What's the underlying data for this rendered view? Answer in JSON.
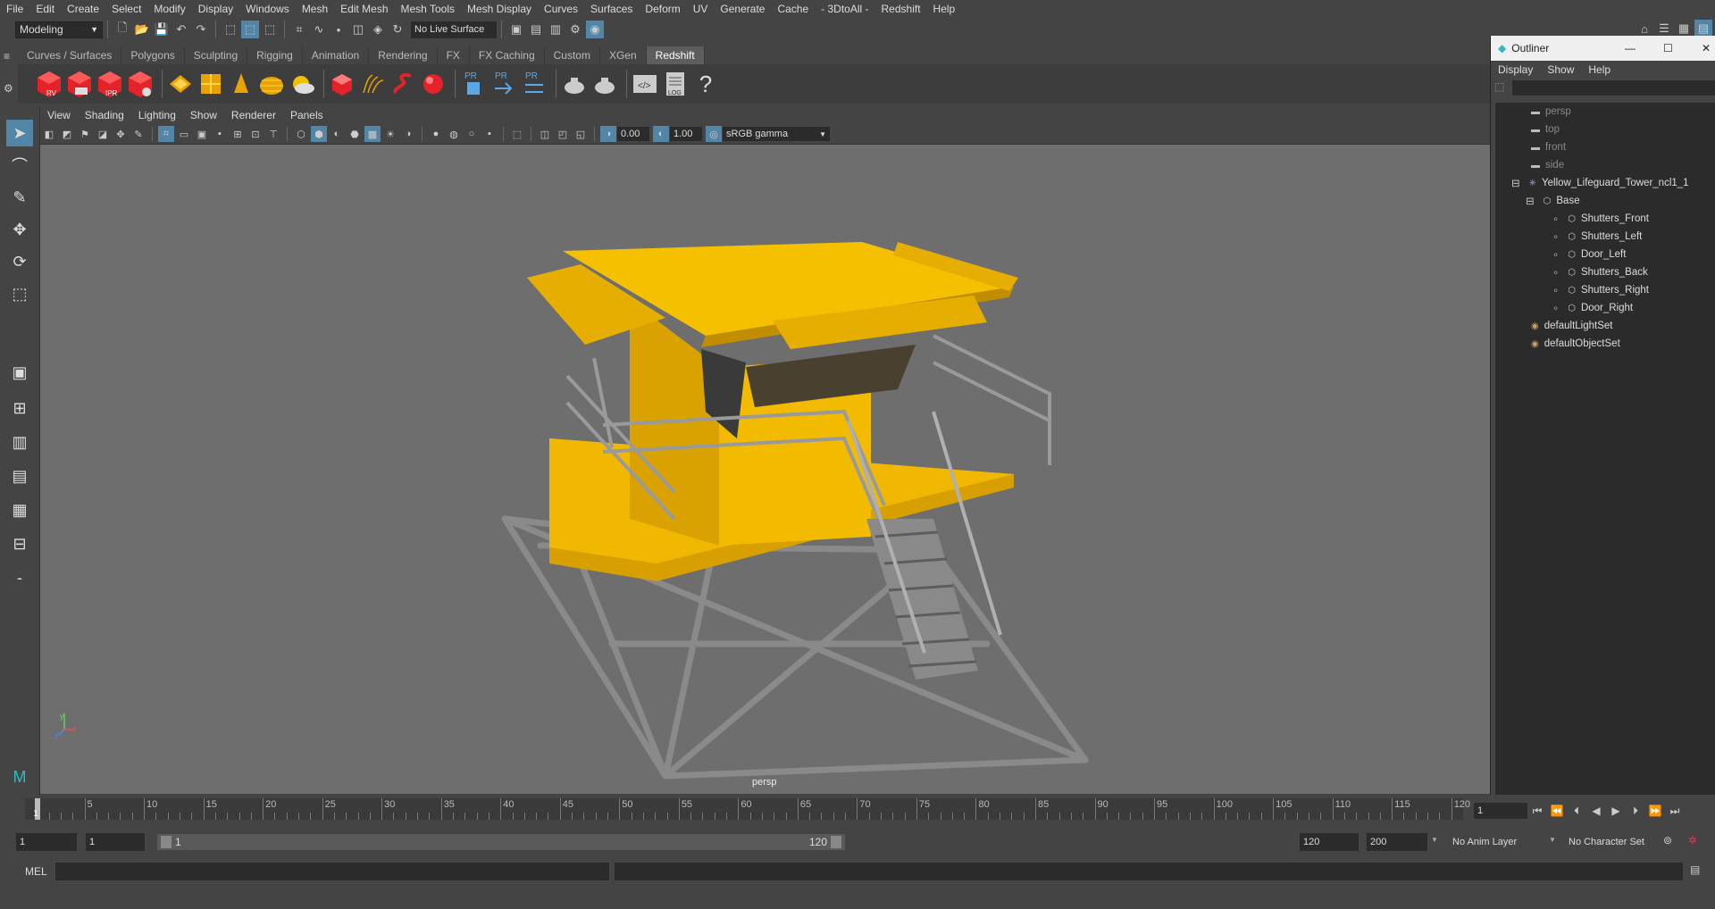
{
  "menubar": [
    "File",
    "Edit",
    "Create",
    "Select",
    "Modify",
    "Display",
    "Windows",
    "Mesh",
    "Edit Mesh",
    "Mesh Tools",
    "Mesh Display",
    "Curves",
    "Surfaces",
    "Deform",
    "UV",
    "Generate",
    "Cache",
    "- 3DtoAll -",
    "Redshift",
    "Help"
  ],
  "status": {
    "mode": "Modeling",
    "live_surface": "No Live Surface"
  },
  "shelf_tabs": [
    "Curves / Surfaces",
    "Polygons",
    "Sculpting",
    "Rigging",
    "Animation",
    "Rendering",
    "FX",
    "FX Caching",
    "Custom",
    "XGen",
    "Redshift"
  ],
  "shelf_active": "Redshift",
  "shelf_icon_labels": {
    "rv": "RV",
    "ipr": "IPR",
    "pr": "PR",
    "log": "LOG",
    "help": "?"
  },
  "panel_menu": [
    "View",
    "Shading",
    "Lighting",
    "Show",
    "Renderer",
    "Panels"
  ],
  "panel_fields": {
    "exposure": "0.00",
    "gamma": "1.00",
    "colorspace": "sRGB gamma"
  },
  "viewport": {
    "camera_label": "persp",
    "axis_x": "x",
    "axis_y": "y",
    "axis_z": "z"
  },
  "outliner": {
    "title": "Outliner",
    "menu": [
      "Display",
      "Show",
      "Help"
    ],
    "items": [
      {
        "label": "persp",
        "type": "camera",
        "dim": true
      },
      {
        "label": "top",
        "type": "camera",
        "dim": true
      },
      {
        "label": "front",
        "type": "camera",
        "dim": true
      },
      {
        "label": "side",
        "type": "camera",
        "dim": true
      },
      {
        "label": "Yellow_Lifeguard_Tower_ncl1_1",
        "type": "group"
      },
      {
        "label": "Base",
        "type": "mesh"
      },
      {
        "label": "Shutters_Front",
        "type": "mesh"
      },
      {
        "label": "Shutters_Left",
        "type": "mesh"
      },
      {
        "label": "Door_Left",
        "type": "mesh"
      },
      {
        "label": "Shutters_Back",
        "type": "mesh"
      },
      {
        "label": "Shutters_Right",
        "type": "mesh"
      },
      {
        "label": "Door_Right",
        "type": "mesh"
      },
      {
        "label": "defaultLightSet",
        "type": "set"
      },
      {
        "label": "defaultObjectSet",
        "type": "set"
      }
    ]
  },
  "timeline": {
    "ticks": [
      "5",
      "10",
      "15",
      "20",
      "25",
      "30",
      "35",
      "40",
      "45",
      "50",
      "55",
      "60",
      "65",
      "70",
      "75",
      "80",
      "85",
      "90",
      "95",
      "100",
      "105",
      "110",
      "115",
      "120"
    ],
    "current_frame_marker": "1",
    "current_frame": "1"
  },
  "range": {
    "start": "1",
    "start2": "1",
    "slider_start": "1",
    "slider_end": "120",
    "end": "120",
    "end2": "200",
    "anim_layer": "No Anim Layer",
    "char_set": "No Character Set"
  },
  "cmd": {
    "label": "MEL"
  },
  "colors": {
    "accent": "#5285a6",
    "tower_yellow": "#e8b400",
    "viewport_bg": "#6e6e6e"
  }
}
